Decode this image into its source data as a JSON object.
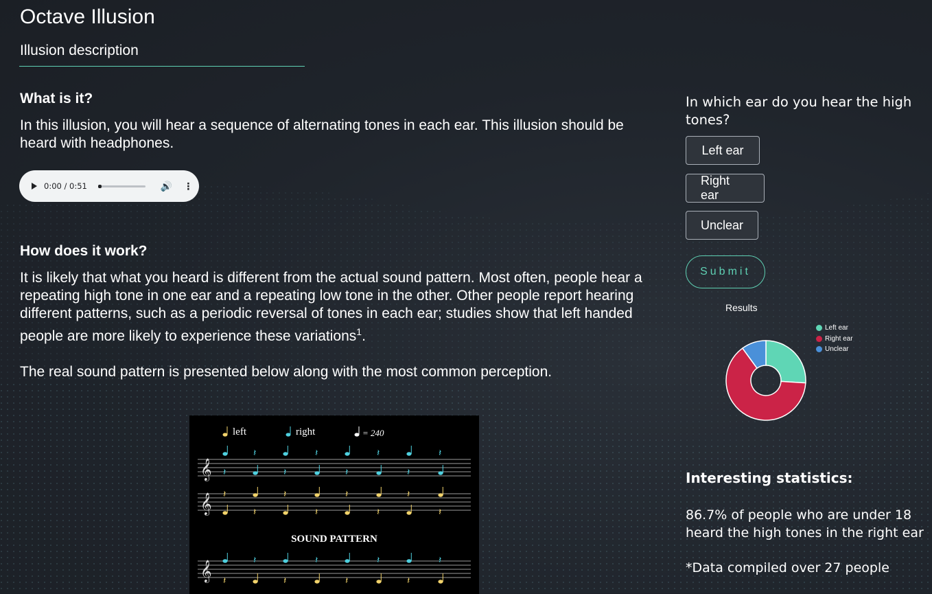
{
  "page": {
    "title": "Octave Illusion",
    "tab_label": "Illusion description"
  },
  "what": {
    "heading": "What is it?",
    "text": "In this illusion, you will hear a sequence of alternating tones in each ear. This illusion should be heard with headphones."
  },
  "audio": {
    "time": "0:00 / 0:51",
    "progress": 0.0
  },
  "how": {
    "heading": "How does it work?",
    "text": "It is likely that what you heard is different from the actual sound pattern. Most often, people hear a repeating high tone in one ear and a repeating low tone in the other. Other people report hearing different patterns, such as a periodic reversal of tones in each ear; studies show that left handed people are more likely to experience these variations",
    "footnote": "1",
    "text_end": ".",
    "real_pattern": "The real sound pattern is presented below along with the most common perception."
  },
  "score": {
    "legend_left": "left",
    "legend_right": "right",
    "tempo": "= 240",
    "caption": "SOUND PATTERN"
  },
  "quiz": {
    "question": "In which ear do you hear the high tones?",
    "options": [
      "Left ear",
      "Right ear",
      "Unclear"
    ],
    "submit_label": "Submit"
  },
  "chart_data": {
    "type": "pie",
    "title": "Results",
    "categories": [
      "Left ear",
      "Right ear",
      "Unclear"
    ],
    "values": [
      26,
      64,
      10
    ],
    "colors": [
      "#5fd6b5",
      "#cb2347",
      "#4a90d9"
    ],
    "legend_position": "top-right"
  },
  "stats": {
    "title": "Interesting statistics:",
    "body": "86.7% of people who are under 18 heard the high tones in the right ear",
    "note": "*Data compiled over 27 people"
  },
  "colors": {
    "accent": "#5fd1b4",
    "cyan_note": "#4fd1e0",
    "yellow_note": "#f2d36b"
  }
}
